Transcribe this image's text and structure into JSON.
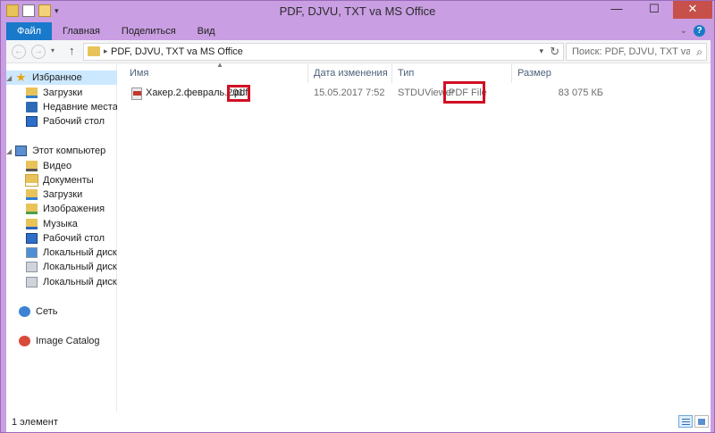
{
  "window": {
    "title": "PDF, DJVU, TXT va MS Office",
    "controls": {
      "minimize": "—",
      "maximize": "☐",
      "close": "✕"
    }
  },
  "quick_access": {
    "icons": [
      "folder-icon",
      "properties-icon",
      "new-folder-icon",
      "customize-arrow-icon"
    ]
  },
  "ribbon": {
    "tabs": [
      {
        "label": "Файл",
        "active": true
      },
      {
        "label": "Главная"
      },
      {
        "label": "Поделиться"
      },
      {
        "label": "Вид"
      }
    ],
    "help": "?"
  },
  "address_bar": {
    "path": "PDF, DJVU, TXT va MS Office",
    "search_placeholder": "Поиск: PDF, DJVU, TXT va MS Office"
  },
  "sidebar": {
    "favorites": {
      "label": "Избранное",
      "items": [
        {
          "label": "Загрузки",
          "icon": "downloads-icon"
        },
        {
          "label": "Недавние места",
          "icon": "recent-places-icon"
        },
        {
          "label": "Рабочий стол",
          "icon": "desktop-icon"
        }
      ]
    },
    "computer": {
      "label": "Этот компьютер",
      "items": [
        {
          "label": "Видео",
          "icon": "videos-icon"
        },
        {
          "label": "Документы",
          "icon": "documents-icon"
        },
        {
          "label": "Загрузки",
          "icon": "downloads-icon"
        },
        {
          "label": "Изображения",
          "icon": "pictures-icon"
        },
        {
          "label": "Музыка",
          "icon": "music-icon"
        },
        {
          "label": "Рабочий стол",
          "icon": "desktop-icon"
        },
        {
          "label": "Локальный диск (C",
          "icon": "local-disk-icon"
        },
        {
          "label": "Локальный диск (D",
          "icon": "local-disk-icon"
        },
        {
          "label": "Локальный диск (E:",
          "icon": "local-disk-icon"
        }
      ]
    },
    "network": {
      "label": "Сеть"
    },
    "image_catalog": {
      "label": "Image Catalog"
    }
  },
  "file_list": {
    "columns": [
      "Имя",
      "Дата изменения",
      "Тип",
      "Размер"
    ],
    "rows": [
      {
        "name_base": "Хакер.2.февраль.201",
        "name_ext": ".pdf",
        "date_modified": "15.05.2017 7:52",
        "type_prefix": "STDUViewer",
        "type_highlight": "PDF File",
        "size": "83 075 КБ"
      }
    ]
  },
  "status_bar": {
    "item_count": "1 элемент"
  },
  "colors": {
    "window_frame": "#c99ee2",
    "file_tab": "#1979ca",
    "selection": "#cce8ff",
    "highlight_box": "#d01024",
    "close_button": "#c7504b"
  }
}
